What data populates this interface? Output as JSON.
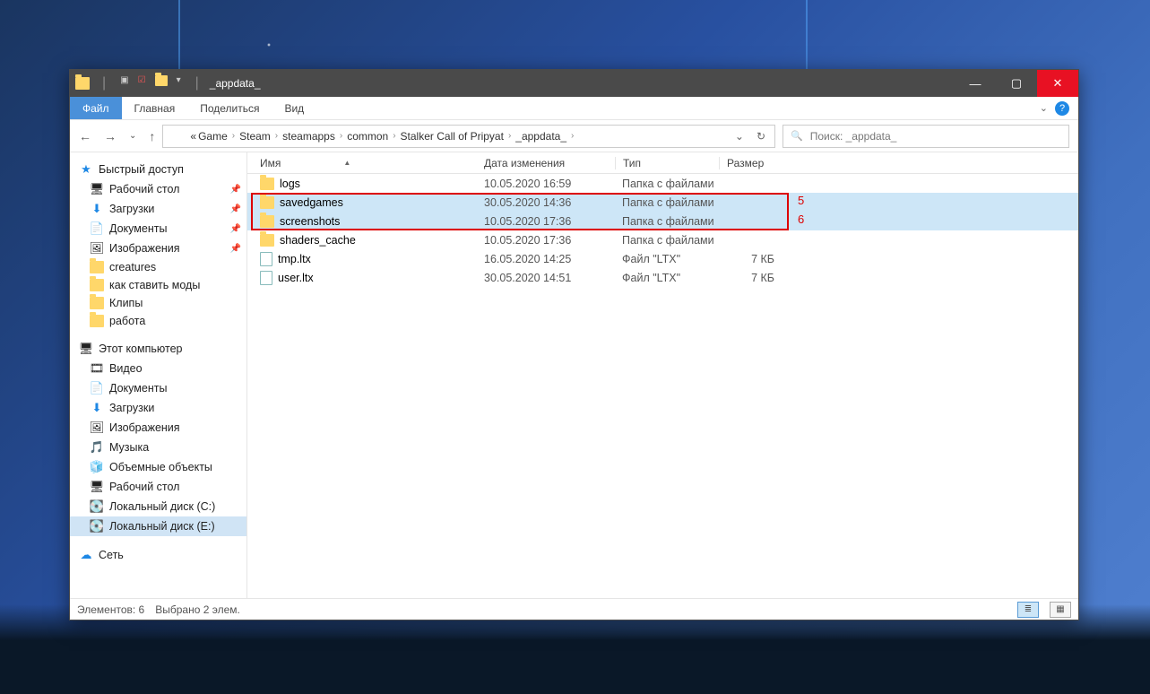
{
  "titlebar": {
    "title": "_appdata_"
  },
  "winbuttons": {
    "min": "—",
    "max": "▢",
    "close": "✕"
  },
  "ribbon": {
    "file": "Файл",
    "tabs": [
      "Главная",
      "Поделиться",
      "Вид"
    ],
    "help": "?"
  },
  "nav": {
    "back": "←",
    "fwd": "→",
    "up": "↑",
    "dropdown": "⌄"
  },
  "breadcrumb": {
    "prefix": "«",
    "items": [
      "Game",
      "Steam",
      "steamapps",
      "common",
      "Stalker Call of Pripyat",
      "_appdata_"
    ]
  },
  "addrbtns": {
    "drop": "⌄",
    "refresh": "↻"
  },
  "search": {
    "icon": "🔍",
    "placeholder": "Поиск: _appdata_"
  },
  "sidebar": {
    "quick": {
      "label": "Быстрый доступ",
      "star": "★",
      "items": [
        {
          "icon": "🖥",
          "label": "Рабочий стол",
          "pinned": true
        },
        {
          "icon": "⬇",
          "label": "Загрузки",
          "pinned": true
        },
        {
          "icon": "📄",
          "label": "Документы",
          "pinned": true
        },
        {
          "icon": "🖼",
          "label": "Изображения",
          "pinned": true
        },
        {
          "icon": "📁",
          "label": "creatures",
          "pinned": false
        },
        {
          "icon": "📁",
          "label": "как ставить моды",
          "pinned": false
        },
        {
          "icon": "📁",
          "label": "Клипы",
          "pinned": false
        },
        {
          "icon": "📁",
          "label": "работа",
          "pinned": false
        }
      ]
    },
    "pc": {
      "label": "Этот компьютер",
      "icon": "🖥",
      "items": [
        {
          "icon": "🎞",
          "label": "Видео"
        },
        {
          "icon": "📄",
          "label": "Документы"
        },
        {
          "icon": "⬇",
          "label": "Загрузки"
        },
        {
          "icon": "🖼",
          "label": "Изображения"
        },
        {
          "icon": "🎵",
          "label": "Музыка"
        },
        {
          "icon": "🧊",
          "label": "Объемные объекты"
        },
        {
          "icon": "🖥",
          "label": "Рабочий стол"
        },
        {
          "icon": "💽",
          "label": "Локальный диск (C:)"
        },
        {
          "icon": "💽",
          "label": "Локальный диск (E:)",
          "selected": true
        }
      ]
    },
    "net": {
      "icon": "☁",
      "label": "Сеть"
    }
  },
  "columns": {
    "name": "Имя",
    "date": "Дата изменения",
    "type": "Тип",
    "size": "Размер"
  },
  "files": [
    {
      "icon": "folder",
      "name": "logs",
      "date": "10.05.2020 16:59",
      "type": "Папка с файлами",
      "size": "",
      "sel": false
    },
    {
      "icon": "folder",
      "name": "savedgames",
      "date": "30.05.2020 14:36",
      "type": "Папка с файлами",
      "size": "",
      "sel": true,
      "annot": "5"
    },
    {
      "icon": "folder",
      "name": "screenshots",
      "date": "10.05.2020 17:36",
      "type": "Папка с файлами",
      "size": "",
      "sel": true,
      "annot": "6"
    },
    {
      "icon": "folder",
      "name": "shaders_cache",
      "date": "10.05.2020 17:36",
      "type": "Папка с файлами",
      "size": "",
      "sel": false
    },
    {
      "icon": "doc",
      "name": "tmp.ltx",
      "date": "16.05.2020 14:25",
      "type": "Файл \"LTX\"",
      "size": "7 КБ",
      "sel": false
    },
    {
      "icon": "doc",
      "name": "user.ltx",
      "date": "30.05.2020 14:51",
      "type": "Файл \"LTX\"",
      "size": "7 КБ",
      "sel": false
    }
  ],
  "status": {
    "count": "Элементов: 6",
    "sel": "Выбрано 2 элем."
  }
}
